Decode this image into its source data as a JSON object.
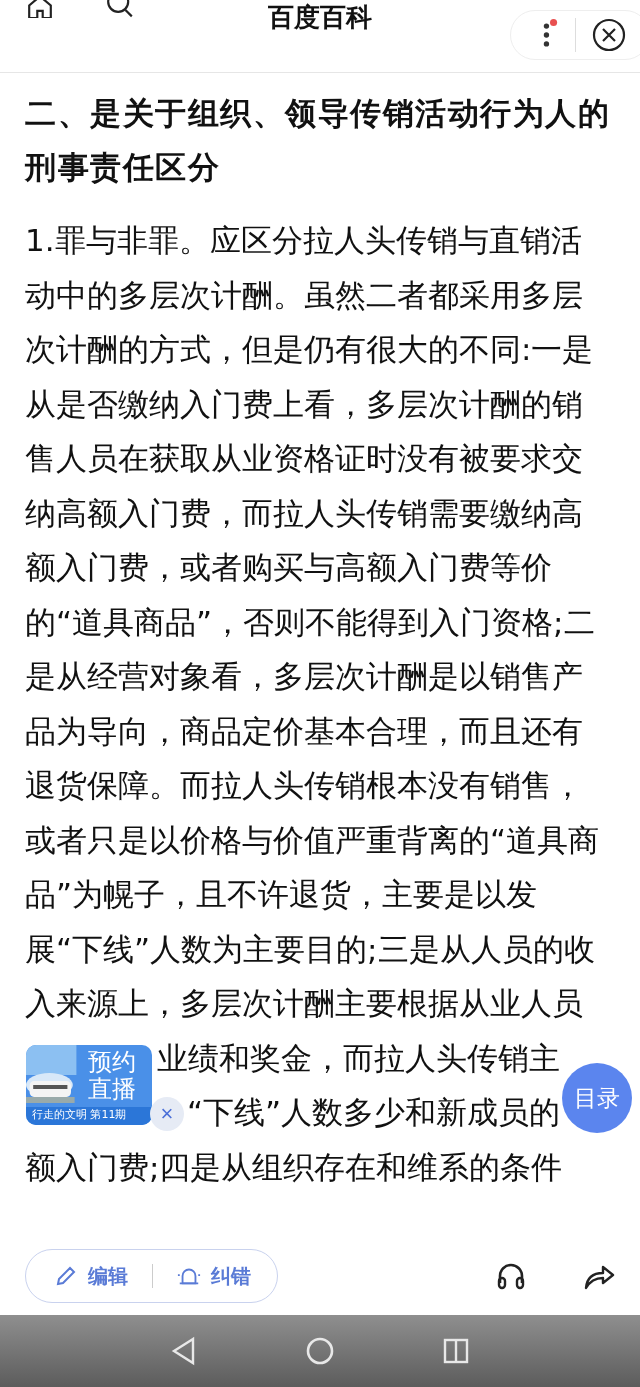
{
  "header": {
    "title": "百度百科",
    "has_notification": true
  },
  "article": {
    "heading": "二、是关于组织、领导传销活动行为人的刑事责任区分",
    "body_lines": [
      {
        "kind": "full",
        "text": "1.罪与非罪。应区分拉人头传销与直销活"
      },
      {
        "kind": "full",
        "text": "动中的多层次计酬。虽然二者都采用多层"
      },
      {
        "kind": "full",
        "text": "次计酬的方式，但是仍有很大的不同:一是"
      },
      {
        "kind": "full",
        "text": "从是否缴纳入门费上看，多层次计酬的销"
      },
      {
        "kind": "full",
        "text": "售人员在获取从业资格证时没有被要求交"
      },
      {
        "kind": "full",
        "text": "纳高额入门费，而拉人头传销需要缴纳高"
      },
      {
        "kind": "full",
        "text": "额入门费，或者购买与高额入门费等价"
      },
      {
        "kind": "full",
        "text": "的“道具商品”，否则不能得到入门资格;二"
      },
      {
        "kind": "full",
        "text": "是从经营对象看，多层次计酬是以销售产"
      },
      {
        "kind": "full",
        "text": "品为导向，商品定价基本合理，而且还有"
      },
      {
        "kind": "full",
        "text": "退货保障。而拉人头传销根本没有销售，"
      },
      {
        "kind": "full",
        "text": "或者只是以价格与价值严重背离的“道具商"
      },
      {
        "kind": "full",
        "text": "品”为幌子，且不许退货，主要是以发"
      },
      {
        "kind": "full",
        "text": "展“下线”人数为主要目的;三是从人员的收"
      },
      {
        "kind": "full",
        "text": "入来源上，多层次计酬主要根据从业人员"
      },
      {
        "kind": "partial",
        "text": "业绩和奖金，而拉人头传销主"
      },
      {
        "kind": "partial",
        "text": "“下线”人数多少和新成员的"
      },
      {
        "kind": "full",
        "text": "额入门费;四是从组织存在和维系的条件"
      }
    ]
  },
  "live_ad": {
    "title": "预约直播",
    "subtitle": "行走的文明 第11期",
    "close": "×"
  },
  "toc_button": "目录",
  "toolbar": {
    "edit": "编辑",
    "correct": "纠错"
  }
}
